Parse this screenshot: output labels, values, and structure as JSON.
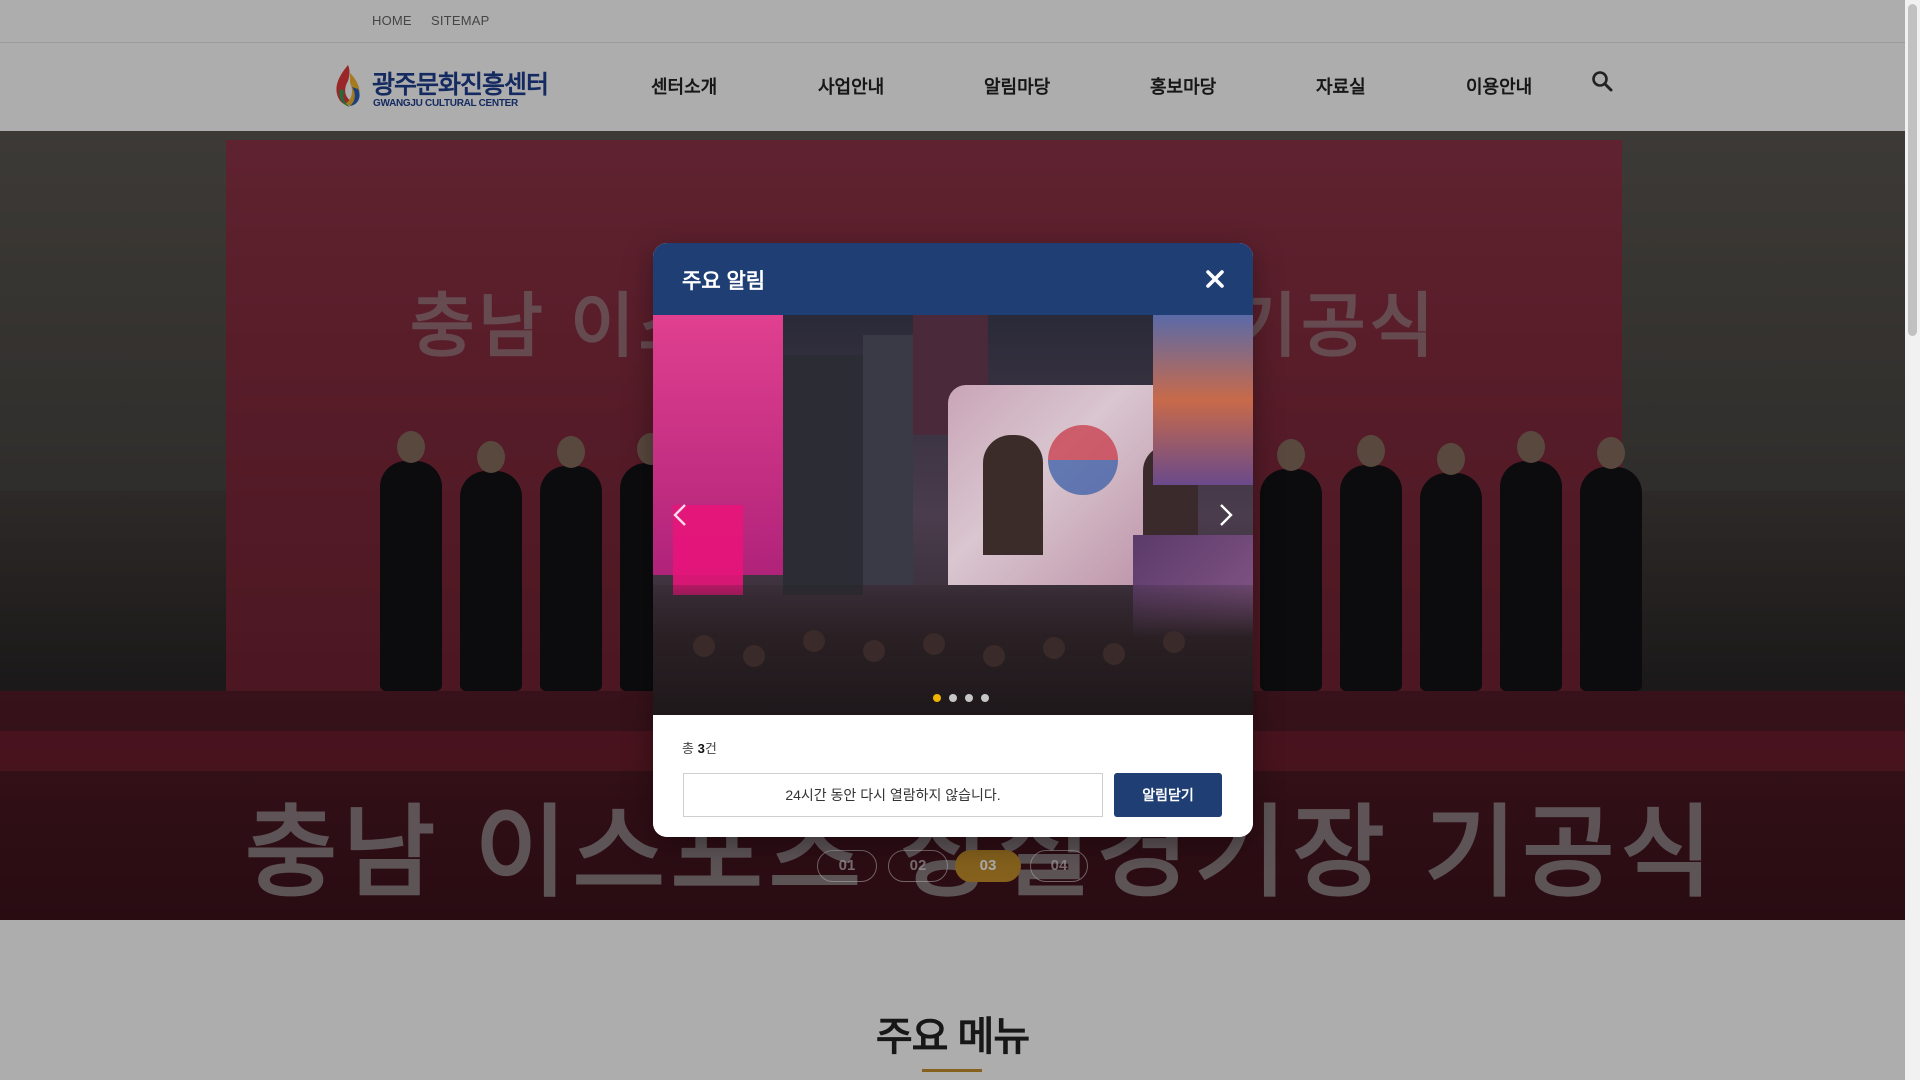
{
  "topbar": {
    "home_label": "HOME",
    "sitemap_label": "SITEMAP"
  },
  "header": {
    "logo_ko": "광주문화진흥센터",
    "logo_en": "GWANGJU CULTURAL CENTER",
    "nav": [
      "센터소개",
      "사업안내",
      "알림마당",
      "홍보마당",
      "자료실",
      "이용안내"
    ],
    "search_icon": "search-icon"
  },
  "hero": {
    "board_title": "충남 이스포츠 상설경기장 기공식",
    "banner_text": "충남 이스포츠 상설경기장 기공식",
    "slides": [
      "01",
      "02",
      "03",
      "04"
    ],
    "active_slide": "03",
    "accent_color": "#c5902b"
  },
  "modal": {
    "title": "주요 알림",
    "close_icon": "close-icon",
    "prev_icon": "chevron-left-icon",
    "next_icon": "chevron-right-icon",
    "slide_count": 4,
    "active_dot": 1,
    "count_prefix": "총 ",
    "count_value": "3",
    "count_suffix": "건",
    "hide_label": "24시간 동안 다시 열람하지 않습니다.",
    "close_label": "알림닫기",
    "header_color": "#1f3f74"
  },
  "main_menu": {
    "title": "주요 메뉴"
  }
}
